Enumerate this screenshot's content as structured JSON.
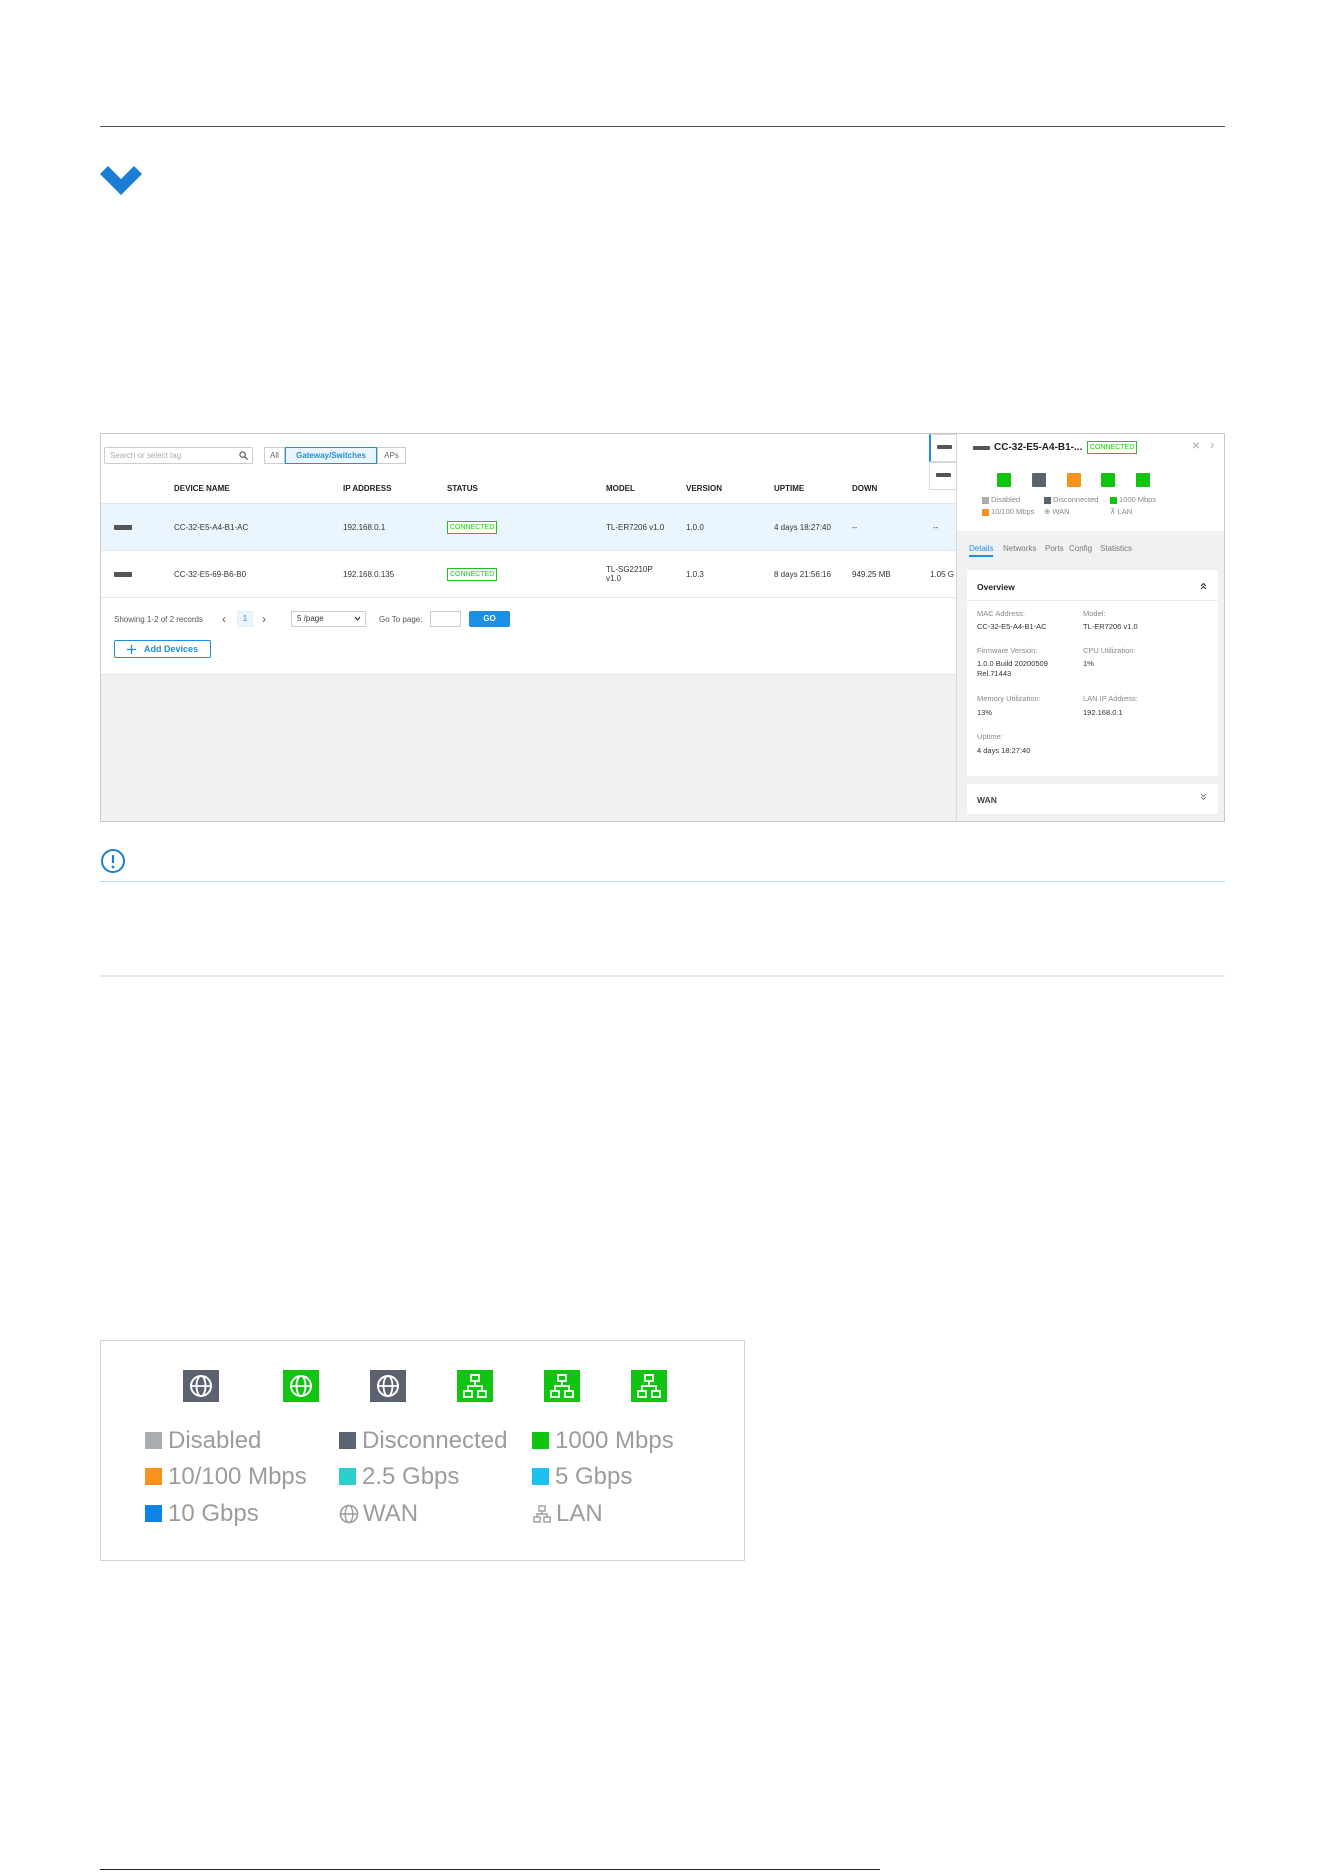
{
  "screenshot": {
    "search_placeholder": "Search or select tag",
    "filter_tabs": [
      "All",
      "Gateway/Switches",
      "APs"
    ],
    "columns": [
      "DEVICE NAME",
      "IP ADDRESS",
      "STATUS",
      "MODEL",
      "VERSION",
      "UPTIME",
      "DOWN"
    ],
    "rows": [
      {
        "name": "CC-32-E5-A4-B1-AC",
        "ip": "192.168.0.1",
        "status": "CONNECTED",
        "model": "TL-ER7206 v1.0",
        "version": "1.0.0",
        "uptime": "4 days 18:27:40",
        "down": "--",
        "extra": "--"
      },
      {
        "name": "CC-32-E5-69-B6-B0",
        "ip": "192.168.0.135",
        "status": "CONNECTED",
        "model_line1": "TL-SG2210P",
        "model_line2": "v1.0",
        "version": "1.0.3",
        "uptime": "8 days 21:56:16",
        "down": "949.25 MB",
        "extra": "1.05 G"
      }
    ],
    "pager": {
      "showing": "Showing 1-2 of 2 records",
      "prev": "‹",
      "page": "1",
      "next": "›",
      "page_size": "5 /page",
      "goto_label": "Go To page:",
      "go": "GO"
    },
    "add_devices": "Add Devices",
    "panel": {
      "device": "CC-32-E5-A4-B1-...",
      "status": "CONNECTED",
      "close": "×",
      "next": "›",
      "legend": {
        "disabled": "Disabled",
        "disconnected": "Disconnected",
        "m1000": "1000 Mbps",
        "m10_100": "10/100 Mbps",
        "wan": "WAN",
        "lan": "LAN"
      },
      "tabs": [
        "Details",
        "Networks",
        "Ports",
        "Config",
        "Statistics"
      ],
      "overview_title": "Overview",
      "fields": {
        "mac_label": "MAC Address:",
        "mac": "CC-32-E5-A4-B1-AC",
        "model_label": "Model:",
        "model": "TL-ER7206 v1.0",
        "fw_label": "Firmware Version:",
        "fw_1": "1.0.0 Build 20200509",
        "fw_2": "Rel.71443",
        "cpu_label": "CPU Utilization:",
        "cpu": "1%",
        "mem_label": "Memory Utilization:",
        "mem": "13%",
        "lanip_label": "LAN IP Address:",
        "lanip": "192.168.0.1",
        "uptime_label": "Uptime:",
        "uptime": "4 days 18:27:40"
      },
      "wan_title": "WAN"
    }
  },
  "legend_image": {
    "items": {
      "disabled": "Disabled",
      "disconnected": "Disconnected",
      "m1000": "1000 Mbps",
      "m10_100": "10/100 Mbps",
      "g2_5": "2.5 Gbps",
      "g5": "5 Gbps",
      "g10": "10 Gbps",
      "wan": "WAN",
      "lan": "LAN"
    }
  },
  "colors": {
    "accent_blue": "#1a8fe3",
    "disabled_grey": "#a9adb0",
    "disconnected_dark": "#5b6270",
    "green_1000": "#11c411",
    "orange_10_100": "#f7921e",
    "teal_2_5": "#2ccfc9",
    "cyan_5": "#1fc0f0",
    "blue_10": "#1283e6"
  }
}
